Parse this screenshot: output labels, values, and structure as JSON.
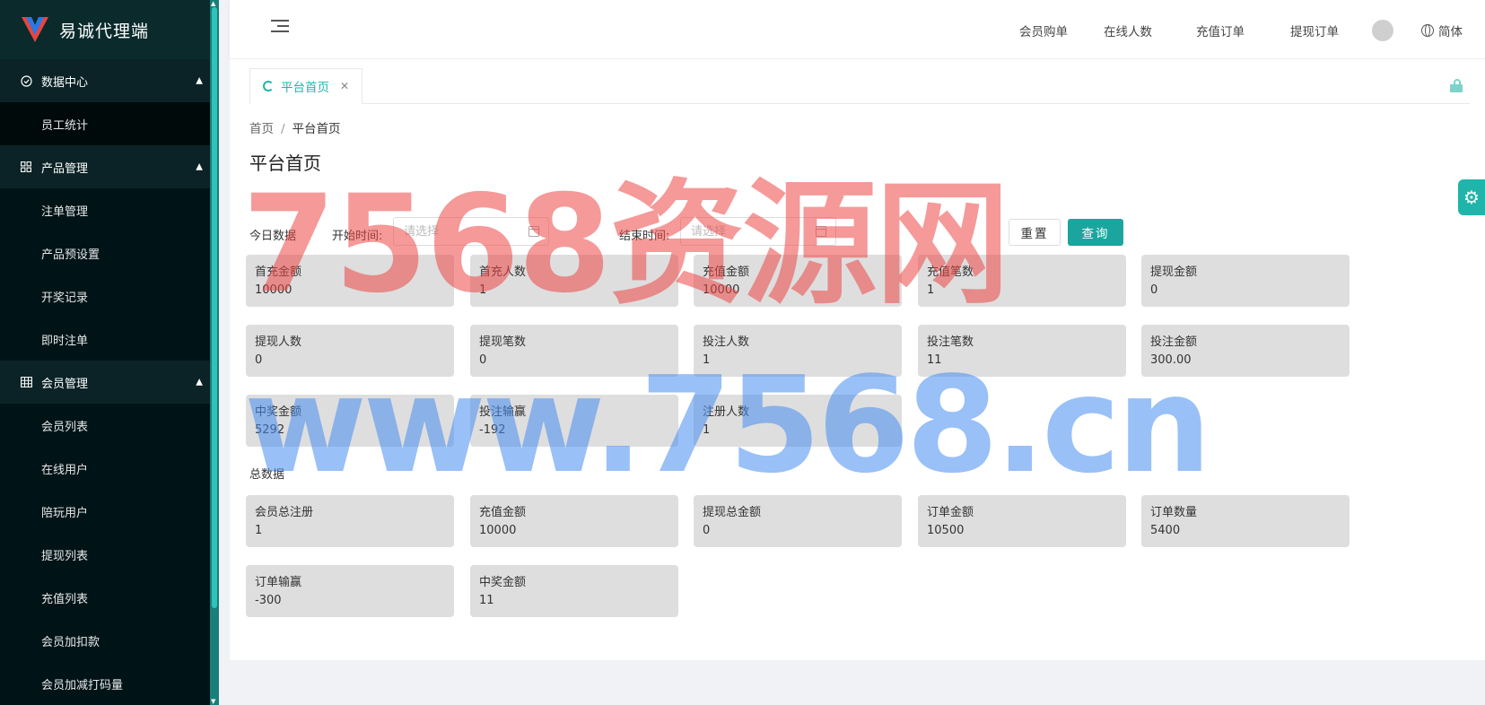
{
  "app": {
    "title": "易诚代理端"
  },
  "sidebar": {
    "groups": [
      {
        "label": "数据中心",
        "icon": "check-circle-icon",
        "items": [
          "员工统计"
        ]
      },
      {
        "label": "产品管理",
        "icon": "grid-icon",
        "items": [
          "注单管理",
          "产品预设置",
          "开奖记录",
          "即时注单"
        ]
      },
      {
        "label": "会员管理",
        "icon": "table-icon",
        "items": [
          "会员列表",
          "在线用户",
          "陪玩用户",
          "提现列表",
          "充值列表",
          "会员加扣款",
          "会员加减打码量"
        ]
      }
    ]
  },
  "header": {
    "links": [
      "会员购单",
      "在线人数",
      "充值订单",
      "提现订单"
    ],
    "language": "简体"
  },
  "tabs": {
    "active": "平台首页"
  },
  "breadcrumb": {
    "home": "首页",
    "current": "平台首页"
  },
  "page": {
    "title": "平台首页"
  },
  "filters": {
    "today_label": "今日数据",
    "start_label": "开始时间:",
    "start_placeholder": "请选择",
    "end_label": "结束时间:",
    "end_placeholder": "请选择",
    "reset": "重置",
    "query": "查询"
  },
  "today": [
    {
      "label": "首充金额",
      "value": "10000"
    },
    {
      "label": "首充人数",
      "value": "1"
    },
    {
      "label": "充值金额",
      "value": "10000"
    },
    {
      "label": "充值笔数",
      "value": "1"
    },
    {
      "label": "提现金额",
      "value": "0"
    },
    {
      "label": "提现人数",
      "value": "0"
    },
    {
      "label": "提现笔数",
      "value": "0"
    },
    {
      "label": "投注人数",
      "value": "1"
    },
    {
      "label": "投注笔数",
      "value": "11"
    },
    {
      "label": "投注金额",
      "value": "300.00"
    },
    {
      "label": "中奖金额",
      "value": "5292"
    },
    {
      "label": "投注输赢",
      "value": "-192"
    },
    {
      "label": "注册人数",
      "value": "1"
    }
  ],
  "total_label": "总数据",
  "total": [
    {
      "label": "会员总注册",
      "value": "1"
    },
    {
      "label": "充值金额",
      "value": "10000"
    },
    {
      "label": "提现总金额",
      "value": "0"
    },
    {
      "label": "订单金额",
      "value": "10500"
    },
    {
      "label": "订单数量",
      "value": "5400"
    },
    {
      "label": "订单输赢",
      "value": "-300"
    },
    {
      "label": "中奖金额",
      "value": "11"
    }
  ],
  "watermark": {
    "line1": "7568资源网",
    "line2": "www.7568.cn"
  },
  "colors": {
    "accent": "#1fb5aa",
    "sidebar_bg": "#001417",
    "card_bg": "#dedede"
  }
}
